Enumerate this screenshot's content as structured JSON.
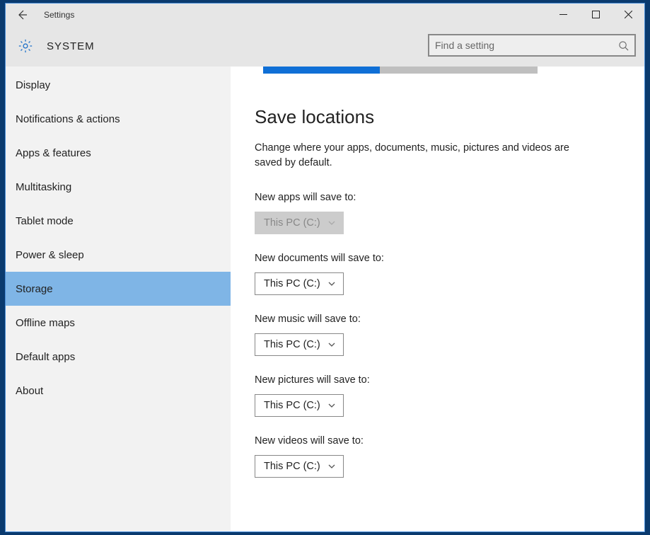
{
  "window": {
    "title": "Settings"
  },
  "header": {
    "title": "SYSTEM"
  },
  "search": {
    "placeholder": "Find a setting"
  },
  "sidebar": {
    "items": [
      {
        "label": "Display",
        "selected": false
      },
      {
        "label": "Notifications & actions",
        "selected": false
      },
      {
        "label": "Apps & features",
        "selected": false
      },
      {
        "label": "Multitasking",
        "selected": false
      },
      {
        "label": "Tablet mode",
        "selected": false
      },
      {
        "label": "Power & sleep",
        "selected": false
      },
      {
        "label": "Storage",
        "selected": true
      },
      {
        "label": "Offline maps",
        "selected": false
      },
      {
        "label": "Default apps",
        "selected": false
      },
      {
        "label": "About",
        "selected": false
      }
    ]
  },
  "content": {
    "section_title": "Save locations",
    "section_desc": "Change where your apps, documents, music, pictures and videos are saved by default.",
    "fields": [
      {
        "label": "New apps will save to:",
        "value": "This PC (C:)",
        "disabled": true
      },
      {
        "label": "New documents will save to:",
        "value": "This PC (C:)",
        "disabled": false
      },
      {
        "label": "New music will save to:",
        "value": "This PC (C:)",
        "disabled": false
      },
      {
        "label": "New pictures will save to:",
        "value": "This PC (C:)",
        "disabled": false
      },
      {
        "label": "New videos will save to:",
        "value": "This PC (C:)",
        "disabled": false
      }
    ]
  }
}
